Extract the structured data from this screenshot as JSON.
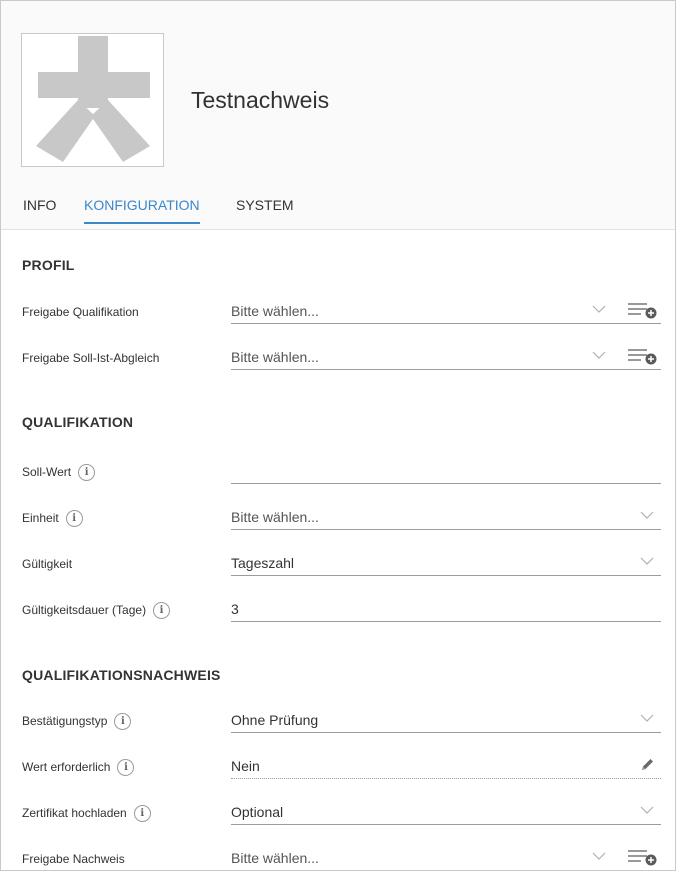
{
  "header": {
    "title": "Testnachweis"
  },
  "tabs": [
    {
      "label": "INFO",
      "active": false
    },
    {
      "label": "KONFIGURATION",
      "active": true
    },
    {
      "label": "SYSTEM",
      "active": false
    }
  ],
  "sections": {
    "profil": {
      "title": "PROFIL",
      "fields": [
        {
          "label": "Freigabe Qualifikation",
          "value": "Bitte wählen..."
        },
        {
          "label": "Freigabe Soll-Ist-Abgleich",
          "value": "Bitte wählen..."
        }
      ]
    },
    "qualifikation": {
      "title": "QUALIFIKATION",
      "fields": [
        {
          "label": "Soll-Wert",
          "value": ""
        },
        {
          "label": "Einheit",
          "value": "Bitte wählen..."
        },
        {
          "label": "Gültigkeit",
          "value": "Tageszahl"
        },
        {
          "label": "Gültigkeitsdauer (Tage)",
          "value": "3"
        }
      ]
    },
    "nachweis": {
      "title": "QUALIFIKATIONSNACHWEIS",
      "fields": [
        {
          "label": "Bestätigungstyp",
          "value": "Ohne Prüfung"
        },
        {
          "label": "Wert erforderlich",
          "value": "Nein"
        },
        {
          "label": "Zertifikat hochladen",
          "value": "Optional"
        },
        {
          "label": "Freigabe Nachweis",
          "value": "Bitte wählen..."
        }
      ]
    }
  },
  "icons": {
    "info": "i",
    "info_icon": "info-circle-icon",
    "chevron": "chevron-down-icon",
    "list_add": "list-add-icon",
    "pencil": "pencil-icon"
  },
  "colors": {
    "accent": "#3b87c8",
    "avatar_placeholder": "#c8c8c8"
  }
}
